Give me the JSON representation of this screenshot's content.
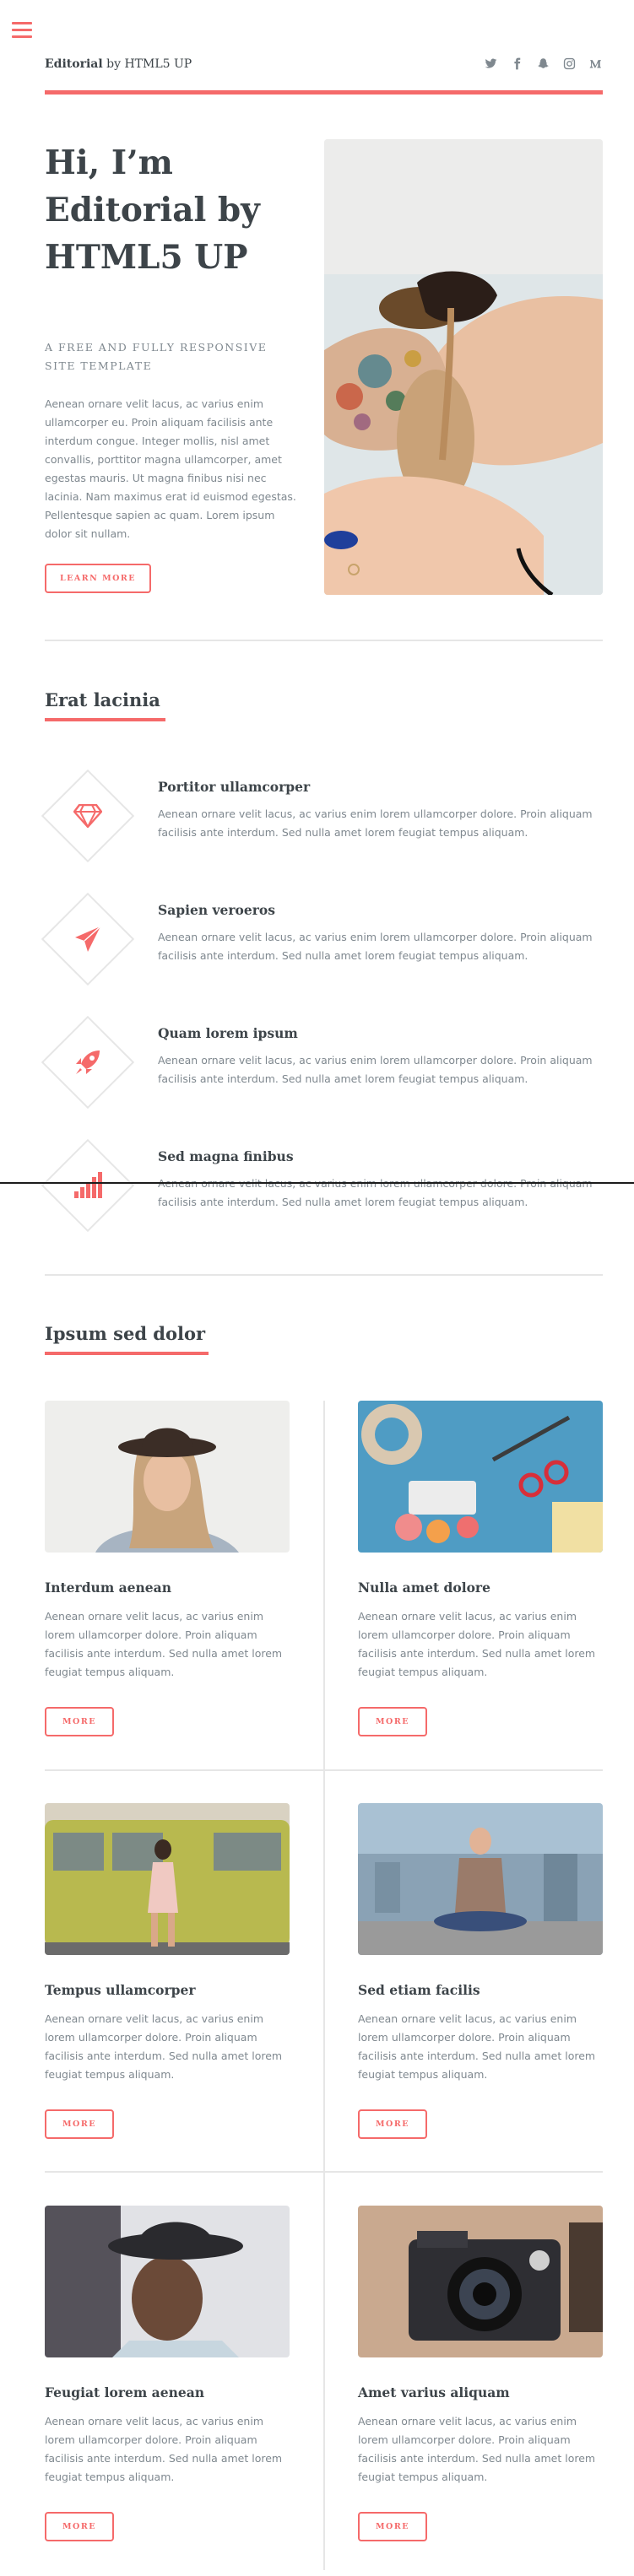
{
  "header": {
    "logo_brand": "Editorial",
    "logo_rest": " by HTML5 UP",
    "social": [
      "twitter-icon",
      "facebook-icon",
      "snapchat-icon",
      "instagram-icon",
      "medium-icon"
    ]
  },
  "banner": {
    "title": "Hi, I’m Editorial by HTML5 UP",
    "subtitle": "A FREE AND FULLY RESPONSIVE SITE TEMPLATE",
    "description": "Aenean ornare velit lacus, ac varius enim ullamcorper eu. Proin aliquam facilisis ante interdum congue. Integer mollis, nisl amet convallis, porttitor magna ullamcorper, amet egestas mauris. Ut magna finibus nisi nec lacinia. Nam maximus erat id euismod egestas. Pellentesque sapien ac quam. Lorem ipsum dolor sit nullam.",
    "button": "LEARN MORE"
  },
  "features_section": {
    "title": "Erat lacinia",
    "items": [
      {
        "icon": "gem-icon",
        "title": "Portitor ullamcorper",
        "text": "Aenean ornare velit lacus, ac varius enim lorem ullamcorper dolore. Proin aliquam facilisis ante interdum. Sed nulla amet lorem feugiat tempus aliquam."
      },
      {
        "icon": "paper-plane-icon",
        "title": "Sapien veroeros",
        "text": "Aenean ornare velit lacus, ac varius enim lorem ullamcorper dolore. Proin aliquam facilisis ante interdum. Sed nulla amet lorem feugiat tempus aliquam."
      },
      {
        "icon": "rocket-icon",
        "title": "Quam lorem ipsum",
        "text": "Aenean ornare velit lacus, ac varius enim lorem ullamcorper dolore. Proin aliquam facilisis ante interdum. Sed nulla amet lorem feugiat tempus aliquam."
      },
      {
        "icon": "signal-icon",
        "title": "Sed magna finibus",
        "text": "Aenean ornare velit lacus, ac varius enim lorem ullamcorper dolore. Proin aliquam facilisis ante interdum. Sed nulla amet lorem feugiat tempus aliquam."
      }
    ]
  },
  "posts_section": {
    "title": "Ipsum sed dolor",
    "posts": [
      {
        "title": "Interdum aenean",
        "text": "Aenean ornare velit lacus, ac varius enim lorem ullamcorper dolore. Proin aliquam facilisis ante interdum. Sed nulla amet lorem feugiat tempus aliquam.",
        "button": "MORE"
      },
      {
        "title": "Nulla amet dolore",
        "text": "Aenean ornare velit lacus, ac varius enim lorem ullamcorper dolore. Proin aliquam facilisis ante interdum. Sed nulla amet lorem feugiat tempus aliquam.",
        "button": "MORE"
      },
      {
        "title": "Tempus ullamcorper",
        "text": "Aenean ornare velit lacus, ac varius enim lorem ullamcorper dolore. Proin aliquam facilisis ante interdum. Sed nulla amet lorem feugiat tempus aliquam.",
        "button": "MORE"
      },
      {
        "title": "Sed etiam facilis",
        "text": "Aenean ornare velit lacus, ac varius enim lorem ullamcorper dolore. Proin aliquam facilisis ante interdum. Sed nulla amet lorem feugiat tempus aliquam.",
        "button": "MORE"
      },
      {
        "title": "Feugiat lorem aenean",
        "text": "Aenean ornare velit lacus, ac varius enim lorem ullamcorper dolore. Proin aliquam facilisis ante interdum. Sed nulla amet lorem feugiat tempus aliquam.",
        "button": "MORE"
      },
      {
        "title": "Amet varius aliquam",
        "text": "Aenean ornare velit lacus, ac varius enim lorem ullamcorper dolore. Proin aliquam facilisis ante interdum. Sed nulla amet lorem feugiat tempus aliquam.",
        "button": "MORE"
      }
    ]
  },
  "colors": {
    "accent": "#f56a6a",
    "heading": "#3d4449",
    "text": "#7f888f",
    "border": "#e6e6e6"
  }
}
